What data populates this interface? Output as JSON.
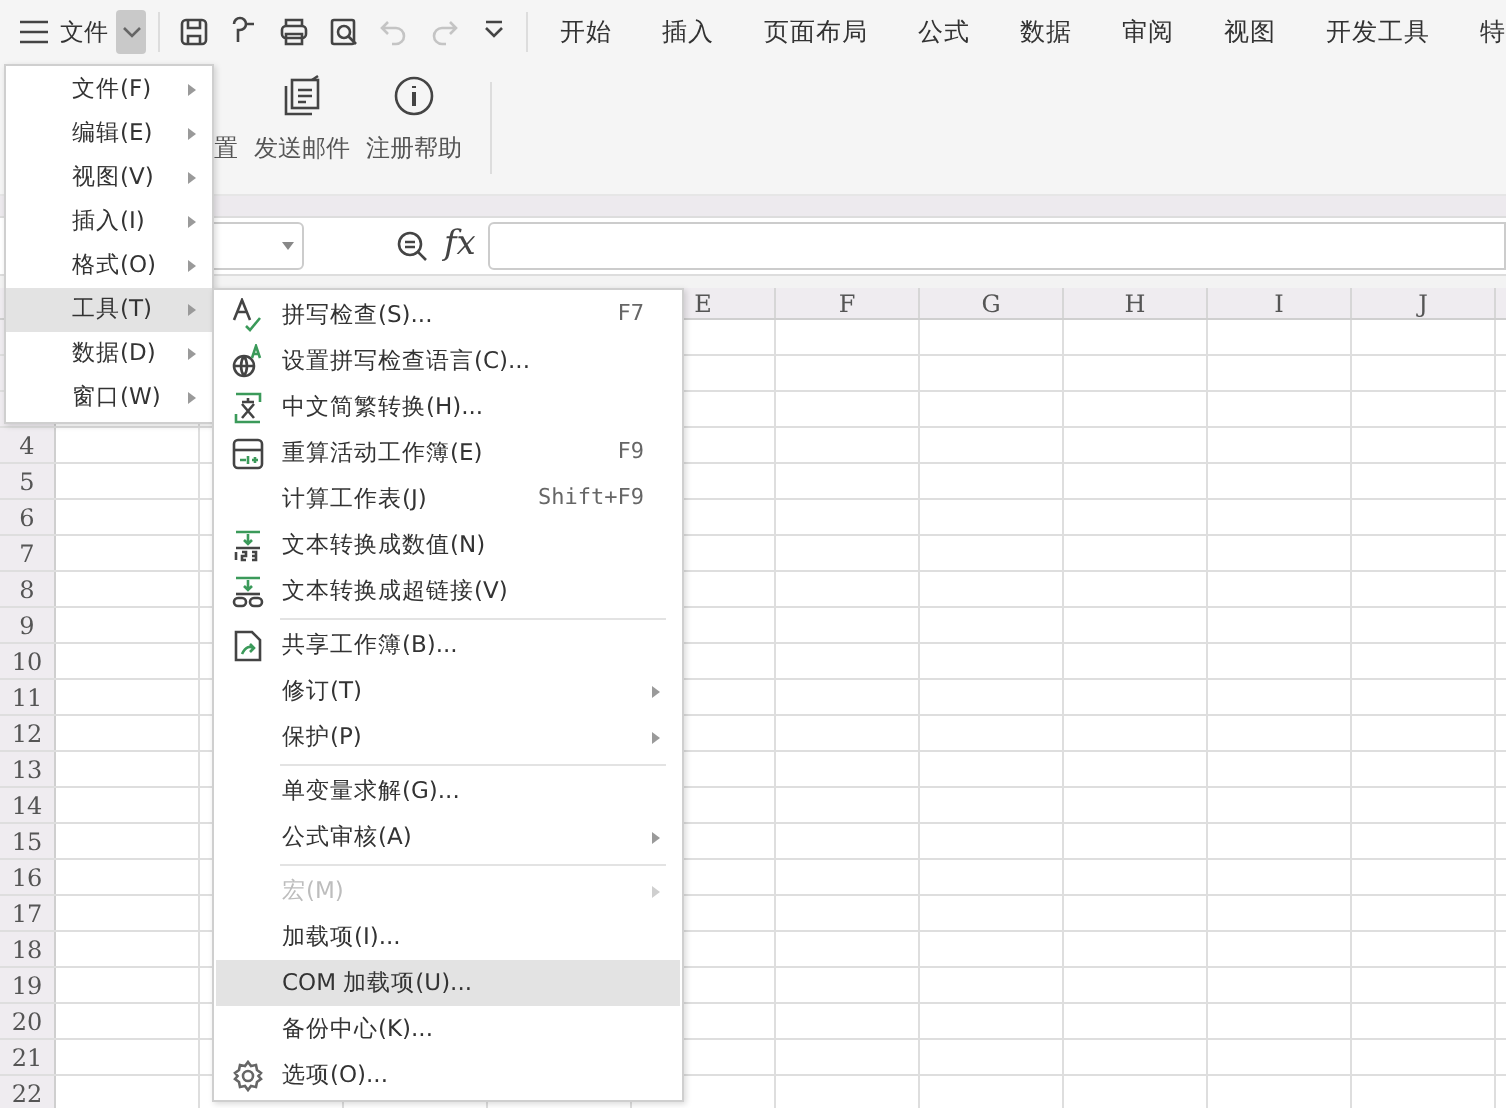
{
  "app_menu_button": {
    "label": "文件",
    "open": true
  },
  "quick_access": [
    {
      "disabled": false
    },
    {
      "disabled": false
    },
    {
      "disabled": false
    },
    {
      "disabled": false
    },
    {
      "disabled": true
    },
    {
      "disabled": true
    },
    {
      "disabled": false
    }
  ],
  "ribbon_tabs": [
    "开始",
    "插入",
    "页面布局",
    "公式",
    "数据",
    "审阅",
    "视图",
    "开发工具",
    "特"
  ],
  "ribbon_buttons": [
    {
      "label": "置"
    },
    {
      "label": "发送邮件"
    },
    {
      "label": "注册帮助"
    }
  ],
  "formula_bar": {
    "fx": "fx"
  },
  "sheet": {
    "columns": [
      "E",
      "F",
      "G",
      "H",
      "I",
      "J"
    ],
    "rows": [
      "4",
      "5",
      "6",
      "7",
      "8",
      "9",
      "10",
      "11",
      "12",
      "13",
      "14",
      "15",
      "16",
      "17",
      "18",
      "19",
      "20",
      "21",
      "22"
    ]
  },
  "menu": [
    {
      "label": "文件(F)",
      "selected": false
    },
    {
      "label": "编辑(E)",
      "selected": false
    },
    {
      "label": "视图(V)",
      "selected": false
    },
    {
      "label": "插入(I)",
      "selected": false
    },
    {
      "label": "格式(O)",
      "selected": false
    },
    {
      "label": "工具(T)",
      "selected": true
    },
    {
      "label": "数据(D)",
      "selected": false
    },
    {
      "label": "窗口(W)",
      "selected": false
    }
  ],
  "submenu": [
    {
      "kind": "item",
      "label": "拼写检查(S)...",
      "shortcut": "F7",
      "submenu": false,
      "disabled": false,
      "selected": false
    },
    {
      "kind": "item",
      "label": "设置拼写检查语言(C)...",
      "submenu": false,
      "disabled": false,
      "selected": false
    },
    {
      "kind": "item",
      "label": "中文简繁转换(H)...",
      "submenu": false,
      "disabled": false,
      "selected": false
    },
    {
      "kind": "item",
      "label": "重算活动工作簿(E)",
      "shortcut": "F9",
      "submenu": false,
      "disabled": false,
      "selected": false
    },
    {
      "kind": "item",
      "label": "计算工作表(J)",
      "shortcut": "Shift+F9",
      "submenu": false,
      "disabled": false,
      "selected": false
    },
    {
      "kind": "item",
      "label": "文本转换成数值(N)",
      "submenu": false,
      "disabled": false,
      "selected": false
    },
    {
      "kind": "item",
      "label": "文本转换成超链接(V)",
      "submenu": false,
      "disabled": false,
      "selected": false
    },
    {
      "kind": "separator"
    },
    {
      "kind": "item",
      "label": "共享工作簿(B)...",
      "submenu": false,
      "disabled": false,
      "selected": false
    },
    {
      "kind": "item",
      "label": "修订(T)",
      "submenu": true,
      "disabled": false,
      "selected": false
    },
    {
      "kind": "item",
      "label": "保护(P)",
      "submenu": true,
      "disabled": false,
      "selected": false
    },
    {
      "kind": "separator"
    },
    {
      "kind": "item",
      "label": "单变量求解(G)...",
      "submenu": false,
      "disabled": false,
      "selected": false
    },
    {
      "kind": "item",
      "label": "公式审核(A)",
      "submenu": true,
      "disabled": false,
      "selected": false
    },
    {
      "kind": "separator"
    },
    {
      "kind": "item",
      "label": "宏(M)",
      "submenu": true,
      "disabled": true,
      "selected": false
    },
    {
      "kind": "item",
      "label": "加载项(I)...",
      "submenu": false,
      "disabled": false,
      "selected": false
    },
    {
      "kind": "item",
      "label": "COM 加载项(U)...",
      "submenu": false,
      "disabled": false,
      "selected": true
    },
    {
      "kind": "item",
      "label": "备份中心(K)...",
      "submenu": false,
      "disabled": false,
      "selected": false
    },
    {
      "kind": "item",
      "label": "选项(O)...",
      "submenu": false,
      "disabled": false,
      "selected": false
    }
  ]
}
